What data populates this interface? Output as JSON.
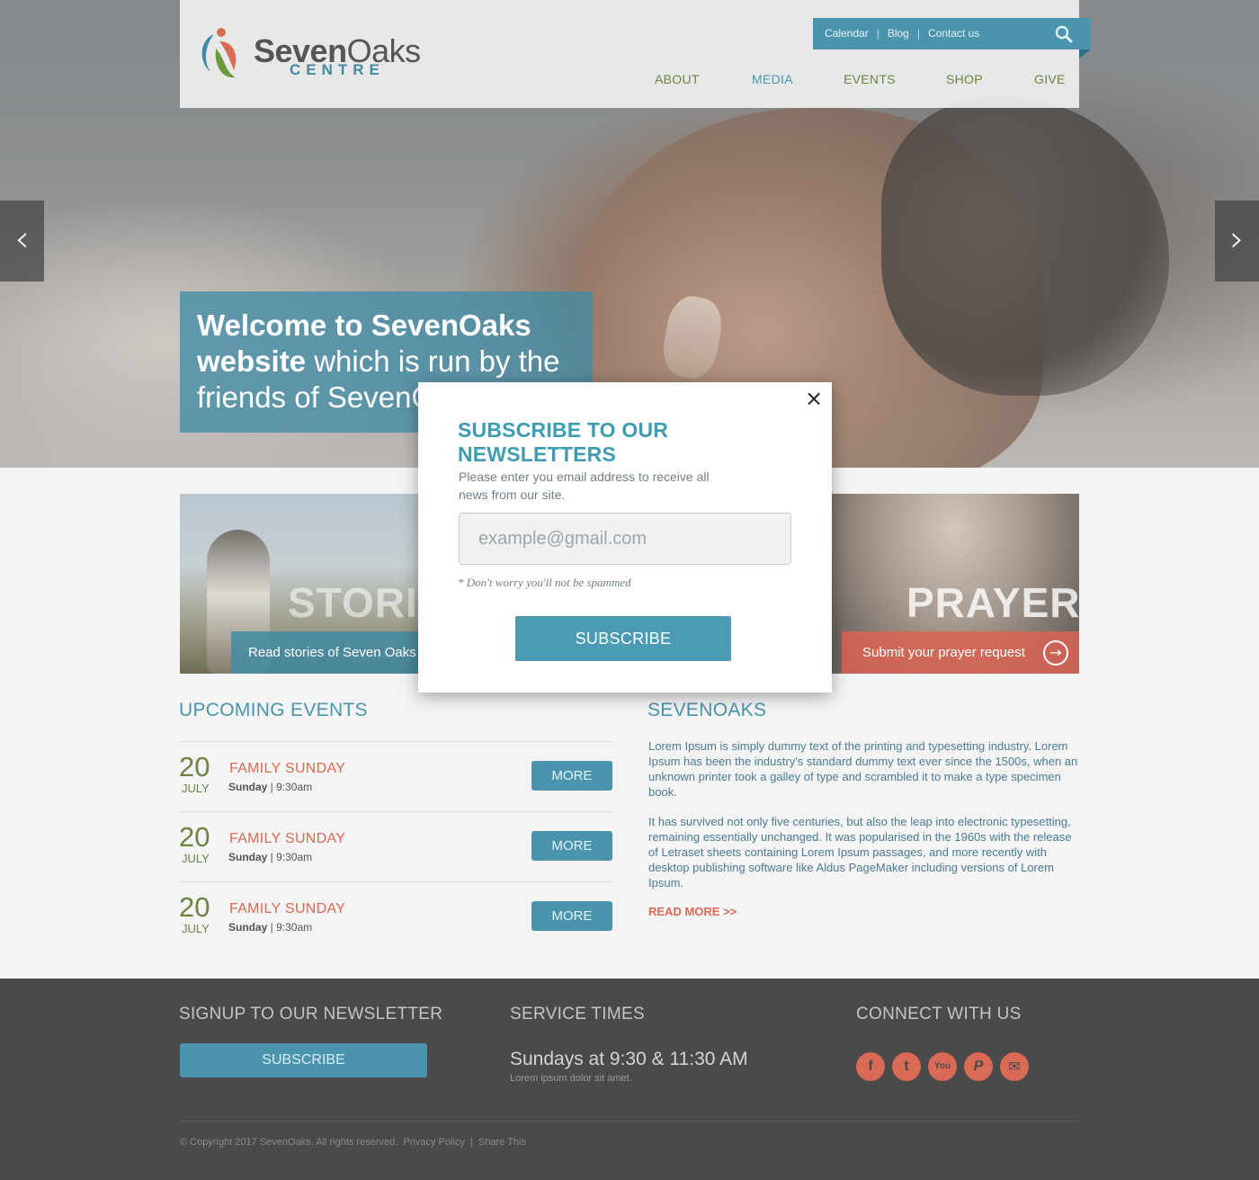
{
  "colors": {
    "accent_blue": "#4a94ad",
    "accent_coral": "#d96a55",
    "accent_green": "#6b8540",
    "footer_bg": "#4a4a4a"
  },
  "header": {
    "logo_word1": "Seven",
    "logo_word2": "Oaks",
    "logo_sub": "CENTRE",
    "toplinks": [
      "Calendar",
      "Blog",
      "Contact us"
    ],
    "search_icon": "search-icon",
    "nav": [
      "ABOUT",
      "MEDIA",
      "EVENTS",
      "SHOP",
      "GIVE"
    ]
  },
  "hero": {
    "prev_icon": "‹",
    "next_icon": "›",
    "welcome_bold": "Welcome to SevenOaks website",
    "welcome_light": " which is run by the friends of SevenOaks"
  },
  "promos": {
    "stories": {
      "title": "STORIES",
      "bar": "Read stories of Seven Oaks"
    },
    "prayer": {
      "title": "PRAYER",
      "bar": "Submit your prayer request",
      "icon": "arrow-right-circle-icon"
    }
  },
  "events": {
    "title": "UPCOMING EVENTS",
    "items": [
      {
        "day": "20",
        "month": "JULY",
        "title": "FAMILY SUNDAY",
        "weekday": "Sunday",
        "time": " | 9:30am",
        "more": "MORE"
      },
      {
        "day": "20",
        "month": "JULY",
        "title": "FAMILY SUNDAY",
        "weekday": "Sunday",
        "time": " | 9:30am",
        "more": "MORE"
      },
      {
        "day": "20",
        "month": "JULY",
        "title": "FAMILY SUNDAY",
        "weekday": "Sunday",
        "time": " | 9:30am",
        "more": "MORE"
      }
    ]
  },
  "about": {
    "title": "SEVENOAKS",
    "p1": "Lorem Ipsum is simply dummy text of the printing and typesetting industry. Lorem Ipsum has been the industry's standard dummy text ever since the 1500s, when an unknown printer took a galley of type and scrambled it to make a type specimen book.",
    "p2": "It has survived not only five centuries, but also the leap into electronic typesetting, remaining essentially unchanged. It was popularised in the 1960s with the release of Letraset sheets containing Lorem Ipsum passages, and more recently with desktop publishing software like Aldus PageMaker including versions of Lorem Ipsum.",
    "read_more": "READ MORE >>"
  },
  "footer": {
    "newsletter_title": "SIGNUP TO OUR NEWSLETTER",
    "subscribe": "SUBSCRIBE",
    "service_title": "SERVICE TIMES",
    "service_times": "Sundays at 9:30 & 11:30 AM",
    "service_sub": "Lorem ipsum dolor sit amet.",
    "connect_title": "CONNECT WITH US",
    "social": [
      {
        "icon": "facebook-icon",
        "glyph": "f"
      },
      {
        "icon": "twitter-icon",
        "glyph": "t"
      },
      {
        "icon": "youtube-icon",
        "glyph": "You"
      },
      {
        "icon": "paypal-icon",
        "glyph": "P"
      },
      {
        "icon": "mail-icon",
        "glyph": "✉"
      }
    ],
    "copyright": "© Copyright 2017 SevenOaks. All rights reserved.",
    "privacy": "Privacy Policy",
    "share": "Share This"
  },
  "modal": {
    "title": "SUBSCRIBE TO OUR NEWSLETTERS",
    "description": "Please enter you email address to receive all news from our site.",
    "input_placeholder": "example@gmail.com",
    "note": "* Don't worry you'll not be spammed",
    "button": "SUBSCRIBE",
    "close": "×"
  }
}
